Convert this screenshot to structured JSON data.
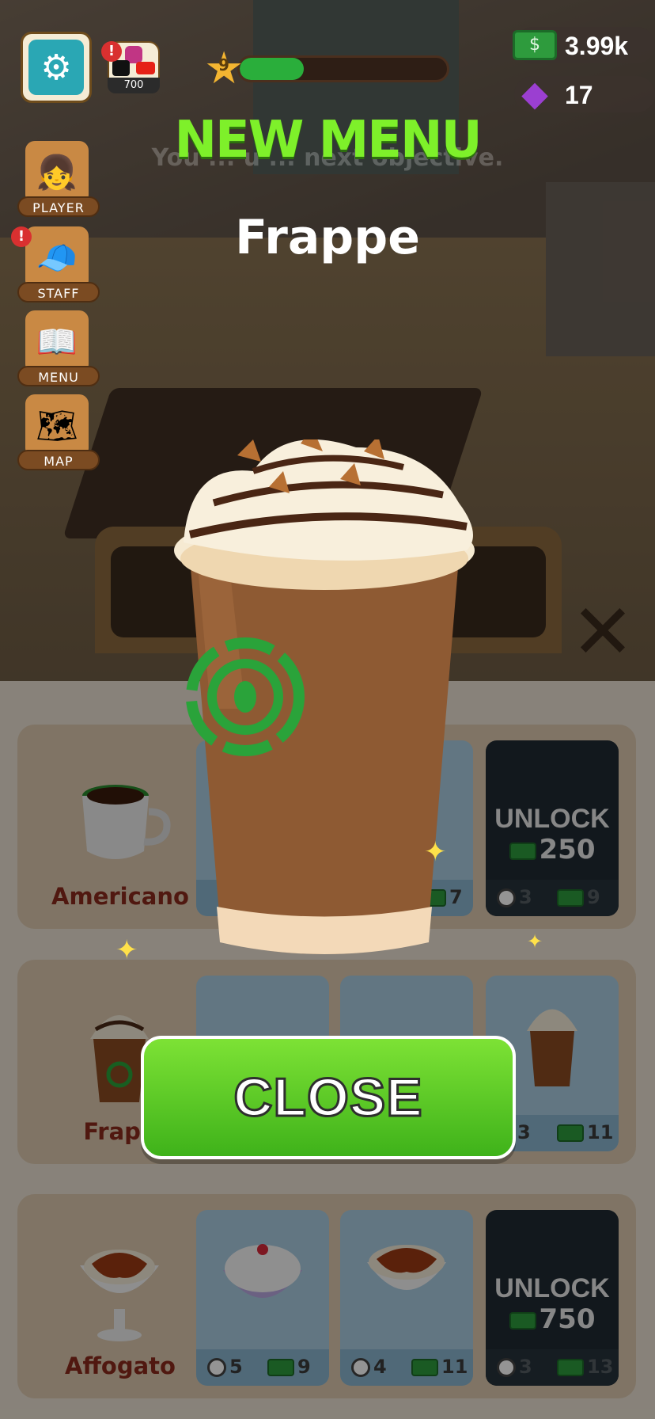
{
  "hud": {
    "social_count": "700",
    "level": "9",
    "xp_fraction": 0.31,
    "cash": "3.99k",
    "gems": "17",
    "side_buttons": [
      {
        "label": "PLAYER",
        "icon": "player-icon"
      },
      {
        "label": "STAFF",
        "icon": "staff-icon"
      },
      {
        "label": "MENU",
        "icon": "menu-book-icon"
      },
      {
        "label": "MAP",
        "icon": "map-icon"
      }
    ]
  },
  "popup": {
    "title": "NEW MENU",
    "item_name": "Frappe",
    "background_hint": "You  ... u ... next objective.",
    "close_label": "CLOSE"
  },
  "menu_rows": [
    {
      "name": "Americano",
      "cards": [
        {
          "time": "",
          "price": ""
        },
        {
          "time": "",
          "price": "7"
        },
        {
          "locked": true,
          "unlock_label": "UNLOCK",
          "unlock_price": "250",
          "time": "3",
          "price": "9"
        }
      ]
    },
    {
      "name": "Frapp",
      "cards": [
        {
          "time": "",
          "price": ""
        },
        {
          "time": "",
          "price": ""
        },
        {
          "time": "3",
          "price": "11"
        }
      ]
    },
    {
      "name": "Affogato",
      "cards": [
        {
          "time": "5",
          "price": "9"
        },
        {
          "time": "4",
          "price": "11"
        },
        {
          "locked": true,
          "unlock_label": "UNLOCK",
          "unlock_price": "750",
          "time": "3",
          "price": "13"
        }
      ]
    }
  ]
}
